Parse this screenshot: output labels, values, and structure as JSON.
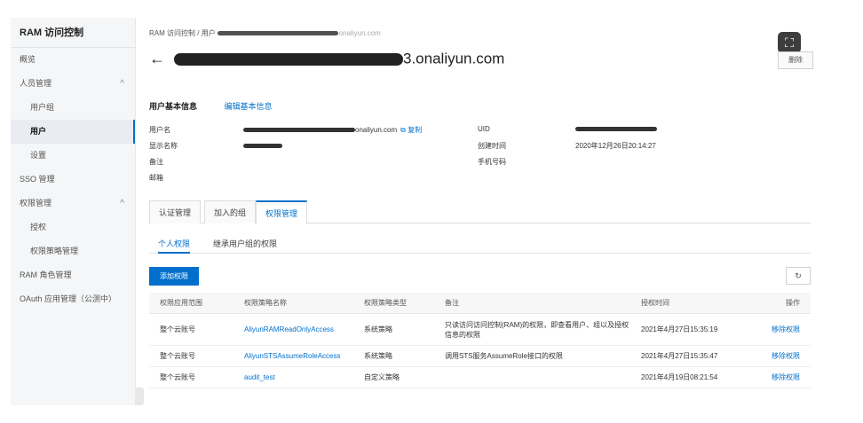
{
  "sidebar": {
    "title": "RAM 访问控制",
    "items": [
      {
        "label": "概览"
      },
      {
        "label": "人员管理",
        "chevron": "^"
      },
      {
        "label": "用户组"
      },
      {
        "label": "用户"
      },
      {
        "label": "设置"
      },
      {
        "label": "SSO 管理"
      },
      {
        "label": "权限管理",
        "chevron": "^"
      },
      {
        "label": "授权"
      },
      {
        "label": "权限策略管理"
      },
      {
        "label": "RAM 角色管理"
      },
      {
        "label": "OAuth 应用管理（公测中）"
      }
    ]
  },
  "breadcrumb": {
    "root": "RAM 访问控制",
    "sep": "/",
    "users": "用户",
    "tail": "onaliyun.com"
  },
  "header": {
    "back": "←",
    "title_tail": "3.onaliyun.com",
    "delete_label": "删除",
    "fullscreen_icon": "⛶"
  },
  "basic_info": {
    "heading": "用户基本信息",
    "edit_link": "编辑基本信息",
    "username_label": "用户名",
    "username_tail": "onaliyun.com",
    "copy_label": "⧉ 复制",
    "display_name_label": "显示名称",
    "note_label": "备注",
    "email_label": "邮箱",
    "uid_label": "UID",
    "created_label": "创建时间",
    "created_value": "2020年12月26日20:14:27",
    "phone_label": "手机号码"
  },
  "tabs": [
    "认证管理",
    "加入的组",
    "权限管理"
  ],
  "subtabs": [
    "个人权限",
    "继承用户组的权限"
  ],
  "actions": {
    "add_label": "添加权限",
    "refresh_icon": "↻"
  },
  "table": {
    "headers": [
      "权限应用范围",
      "权限策略名称",
      "权限策略类型",
      "备注",
      "授权时间",
      "操作"
    ],
    "rows": [
      {
        "scope": "整个云账号",
        "policy": "AliyunRAMReadOnlyAccess",
        "type": "系统策略",
        "note": "只读访问访问控制(RAM)的权限，即查看用户、组以及授权信息的权限",
        "time": "2021年4月27日15:35:19",
        "action": "移除权限"
      },
      {
        "scope": "整个云账号",
        "policy": "AliyunSTSAssumeRoleAccess",
        "type": "系统策略",
        "note": "调用STS服务AssumeRole接口的权限",
        "time": "2021年4月27日15:35:47",
        "action": "移除权限"
      },
      {
        "scope": "整个云账号",
        "policy": "audit_test",
        "type": "自定义策略",
        "note": "",
        "time": "2021年4月19日08:21:54",
        "action": "移除权限"
      }
    ]
  }
}
